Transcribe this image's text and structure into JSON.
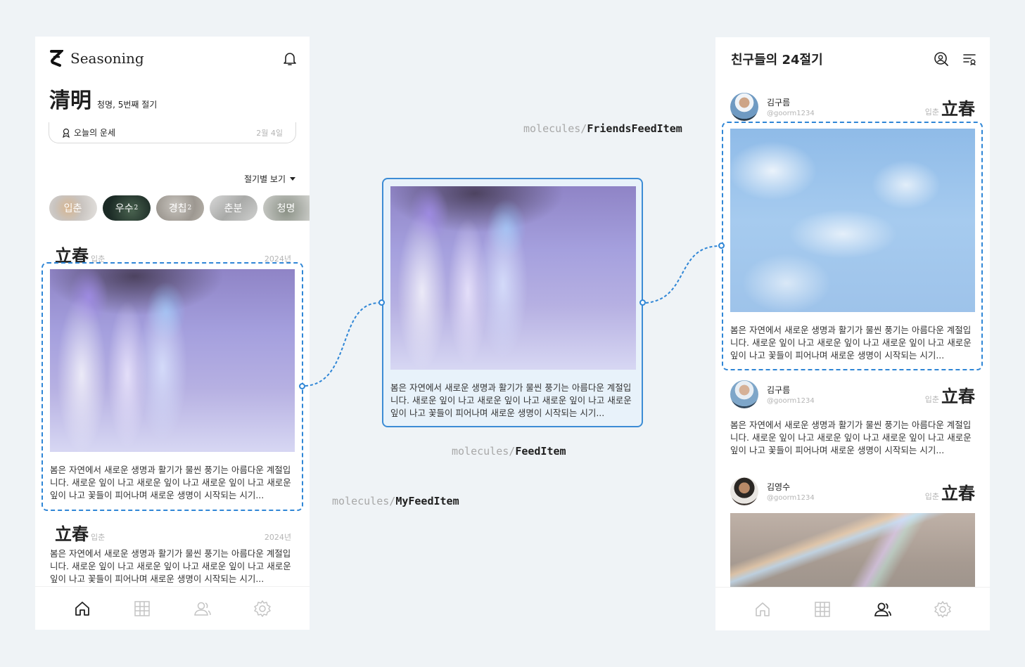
{
  "left": {
    "brand": "Seasoning",
    "hanja": "清明",
    "subtitle": "청명, 5번째 절기",
    "fortune": {
      "label": "오늘의 운세",
      "date": "2월 4일"
    },
    "season_view": "절기별 보기",
    "chips": [
      {
        "label": "입춘",
        "count": ""
      },
      {
        "label": "우수",
        "count": "2"
      },
      {
        "label": "경칩",
        "count": "2"
      },
      {
        "label": "춘분",
        "count": ""
      },
      {
        "label": "청명",
        "count": ""
      }
    ],
    "feed1": {
      "hanja": "立春",
      "kr": "입춘",
      "year": "2024년"
    },
    "feed2": {
      "hanja": "立春",
      "kr": "입춘",
      "year": "2024년"
    },
    "text": "봄은 자연에서 새로운 생명과 활기가 물씬 풍기는 아름다운 계절입니다. 새로운 잎이 나고 새로운 잎이 나고 새로운 잎이 나고 새로운 잎이 나고 꽃들이 피어나며 새로운 생명이 시작되는 시기..."
  },
  "labels": {
    "prefix": "molecules/",
    "friends": "FriendsFeedItem",
    "feed": "FeedItem",
    "my": "MyFeedItem"
  },
  "middle": {
    "text": "봄은 자연에서 새로운 생명과 활기가 물씬 풍기는 아름다운 계절입니다. 새로운 잎이 나고 새로운 잎이 나고 새로운 잎이 나고 새로운 잎이 나고 꽃들이 피어나며 새로운 생명이 시작되는 시기..."
  },
  "right": {
    "title": "친구들의 24절기",
    "items": [
      {
        "name": "김구름",
        "id": "@goorm1234",
        "kr": "입춘",
        "hanja": "立春",
        "text": "봄은 자연에서 새로운 생명과 활기가 물씬 풍기는 아름다운 계절입니다. 새로운 잎이 나고 새로운 잎이 나고 새로운 잎이 나고 새로운 잎이 나고 꽃들이 피어나며 새로운 생명이 시작되는 시기..."
      },
      {
        "name": "김구름",
        "id": "@goorm1234",
        "kr": "입춘",
        "hanja": "立春",
        "text": "봄은 자연에서 새로운 생명과 활기가 물씬 풍기는 아름다운 계절입니다. 새로운 잎이 나고 새로운 잎이 나고 새로운 잎이 나고 새로운 잎이 나고 꽃들이 피어나며 새로운 생명이 시작되는 시기..."
      },
      {
        "name": "김영수",
        "id": "@goorm1234",
        "kr": "입춘",
        "hanja": "立春"
      }
    ]
  },
  "nav": [
    "home-icon",
    "grid-icon",
    "friends-icon",
    "settings-icon"
  ],
  "colors": {
    "accent": "#2f86d6",
    "background": "#eff3f6",
    "active_icon": "#222222",
    "inactive_icon": "#c4c4c4"
  }
}
